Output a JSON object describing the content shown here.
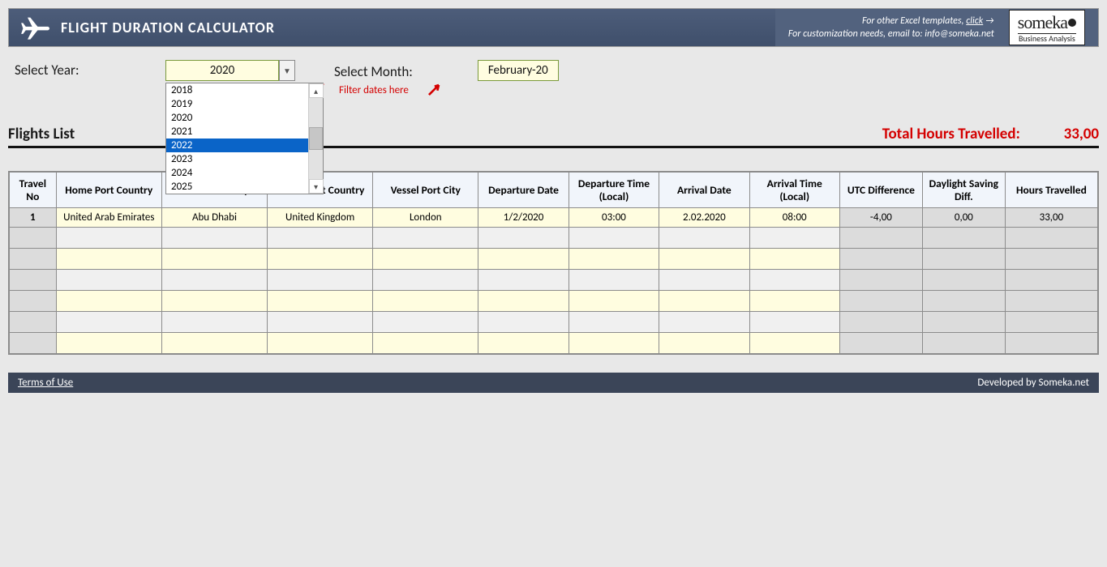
{
  "header": {
    "title": "FLIGHT DURATION CALCULATOR",
    "info_line1_pre": "For other Excel templates, ",
    "info_line1_link": "click",
    "info_line2_pre": "For customization needs, email to: ",
    "info_line2_email": "info@someka.net",
    "logo_top": "someka",
    "logo_bot": "Business Analysis"
  },
  "filters": {
    "year_label": "Select Year:",
    "year_value": "2020",
    "month_label": "Select Month:",
    "month_value": "February-20",
    "hint": "Filter dates here",
    "dropdown_options": [
      "2018",
      "2019",
      "2020",
      "2021",
      "2022",
      "2023",
      "2024",
      "2025"
    ],
    "dropdown_selected": "2022"
  },
  "list": {
    "title": "Flights List",
    "total_label": "Total Hours Travelled:",
    "total_value": "33,00"
  },
  "table": {
    "headers": [
      "Travel No",
      "Home Port Country",
      "Home Port City",
      "Vessel Port Country",
      "Vessel Port City",
      "Departure Date",
      "Departure Time (Local)",
      "Arrival Date",
      "Arrival Time (Local)",
      "UTC Difference",
      "Daylight Saving Diff.",
      "Hours Travelled"
    ],
    "rows": [
      {
        "no": "1",
        "hpc": "United Arab Emirates",
        "hpci": "Abu Dhabi",
        "vpc": "United Kingdom",
        "vpci": "London",
        "dd": "1/2/2020",
        "dt": "03:00",
        "ad": "2.02.2020",
        "at": "08:00",
        "utc": "-4,00",
        "ds": "0,00",
        "ht": "33,00"
      }
    ],
    "empty_rows": 6
  },
  "footer": {
    "terms": "Terms of Use",
    "dev": "Developed by Someka.net"
  }
}
